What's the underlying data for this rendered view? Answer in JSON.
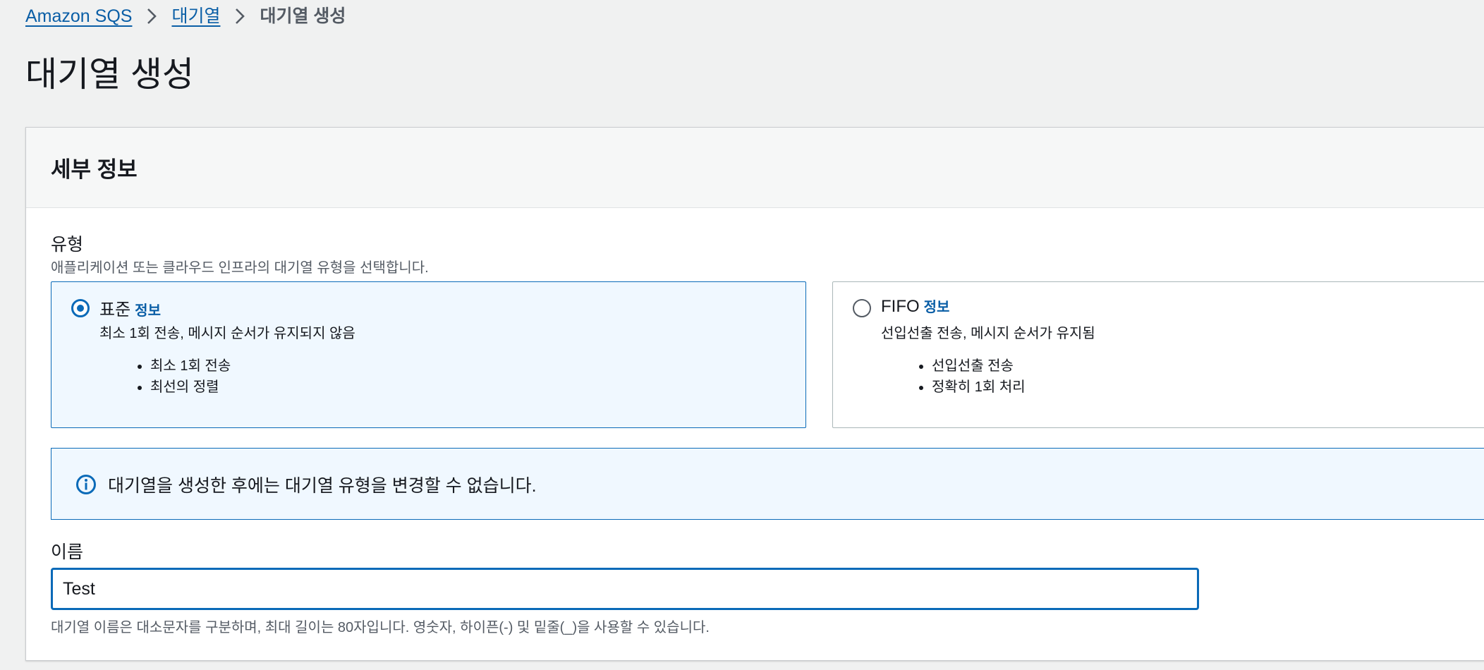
{
  "breadcrumb": {
    "items": [
      "Amazon SQS",
      "대기열"
    ],
    "current": "대기열 생성"
  },
  "page_title": "대기열 생성",
  "panel": {
    "header_title": "세부 정보",
    "type_section": {
      "label": "유형",
      "description": "애플리케이션 또는 클라우드 인프라의 대기열 유형을 선택합니다.",
      "options": [
        {
          "title": "표준",
          "info": "정보",
          "subtitle": "최소 1회 전송, 메시지 순서가 유지되지 않음",
          "bullets": [
            "최소 1회 전송",
            "최선의 정렬"
          ],
          "selected": true
        },
        {
          "title": "FIFO",
          "info": "정보",
          "subtitle": "선입선출 전송, 메시지 순서가 유지됨",
          "bullets": [
            "선입선출 전송",
            "정확히 1회 처리"
          ],
          "selected": false
        }
      ]
    },
    "alert": {
      "icon": "info-icon",
      "text": "대기열을 생성한 후에는 대기열 유형을 변경할 수 없습니다."
    },
    "name_section": {
      "label": "이름",
      "value": "Test",
      "hint": "대기열 이름은 대소문자를 구분하며, 최대 길이는 80자입니다. 영숫자, 하이픈(-) 및 밑줄(_)을 사용할 수 있습니다."
    }
  },
  "colors": {
    "link": "#0a5ea6",
    "accent": "#0a6ab8",
    "selected_bg": "#f0f8ff",
    "page_bg": "#f0f1f1"
  }
}
